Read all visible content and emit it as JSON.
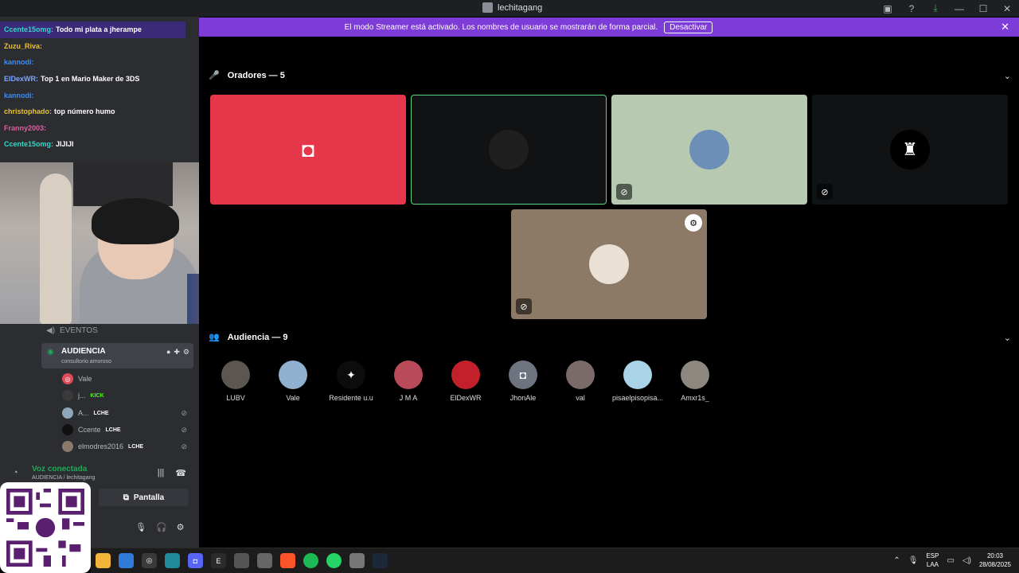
{
  "window": {
    "title": "lechitagang"
  },
  "banner": {
    "text": "El modo Streamer está activado. Los nombres de usuario se mostrarán de forma parcial.",
    "button": "Desactivar"
  },
  "chat": [
    {
      "user": "Ccente15omg:",
      "msg": "Todo mi plata a jherampe",
      "color": "#35d6c9"
    },
    {
      "user": "Zuzu_Riva:",
      "msg": "",
      "color": "#e8c23a"
    },
    {
      "user": "kannodi:",
      "msg": "",
      "color": "#3c8cf0"
    },
    {
      "user": "ElDexWR:",
      "msg": "Top 1 en Mario Maker de 3DS",
      "color": "#7aa6ff"
    },
    {
      "user": "kannodi:",
      "msg": "",
      "color": "#3c8cf0"
    },
    {
      "user": "christophado:",
      "msg": "top número humo",
      "color": "#e8c23a"
    },
    {
      "user": "Franny2003:",
      "msg": "",
      "color": "#e05ca0"
    },
    {
      "user": "Ccente15omg:",
      "msg": "JIJIJI",
      "color": "#35d6c9"
    }
  ],
  "stage": {
    "speakers_heading": "Oradores — 5",
    "audience_heading": "Audiencia — 9",
    "audience": [
      {
        "name": "LUBV",
        "color": "#5b5750"
      },
      {
        "name": "Vale",
        "color": "#8fb0cf"
      },
      {
        "name": "Residente u.u",
        "color": "#0c0c0c"
      },
      {
        "name": "J M A",
        "color": "#b84a5a"
      },
      {
        "name": "ElDexWR",
        "color": "#c2202a"
      },
      {
        "name": "JhonAle",
        "color": "#6d7480"
      },
      {
        "name": "val",
        "color": "#7a6a6a"
      },
      {
        "name": "pisaelpisopisa...",
        "color": "#a9d3e6"
      },
      {
        "name": "Amxr1s_",
        "color": "#8c8880"
      }
    ]
  },
  "sidebar": {
    "events": "EVENTOS",
    "channel": {
      "name": "AUDIENCIA",
      "topic": "consultorio amoroso"
    },
    "members": [
      {
        "name": "Vale",
        "tag": "",
        "color": "#e04b5a"
      },
      {
        "name": "j...",
        "tag": "KICK",
        "color": "#3a3a3a"
      },
      {
        "name": "A...",
        "tag": "LCHE",
        "color": "#8fa7b8"
      },
      {
        "name": "Ccente",
        "tag": "LCHE",
        "color": "#111111"
      },
      {
        "name": "elmodres2016",
        "tag": "LCHE",
        "color": "#8a7a6a"
      }
    ],
    "voice_status": "Voz conectada",
    "voice_channel": "AUDIENCIA / lechitagang",
    "screen_button": "Pantalla"
  },
  "taskbar": {
    "lang_top": "ESP",
    "lang_bottom": "LAA",
    "time": "20:03",
    "date": "28/08/2025"
  },
  "colors": {
    "banner": "#7d3bd8",
    "discord_red": "#e5364a",
    "connected": "#23a55a"
  }
}
